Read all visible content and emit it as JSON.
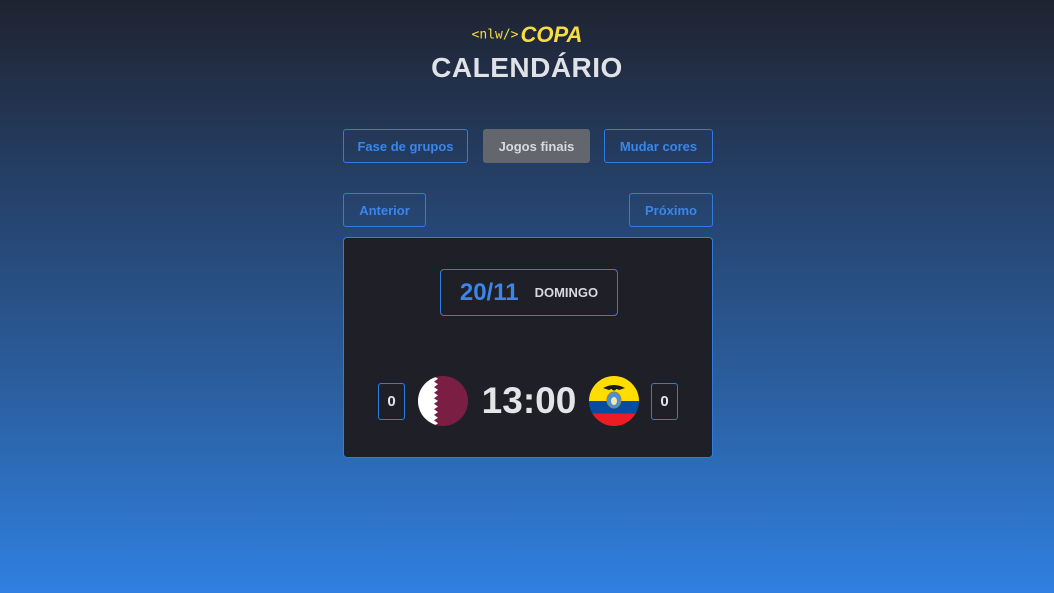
{
  "header": {
    "logo_tag": "<nlw/>",
    "logo_brand": "COPA",
    "title": "CALENDÁRIO"
  },
  "tabs": [
    {
      "label": "Fase de grupos",
      "active": false
    },
    {
      "label": "Jogos finais",
      "active": true
    },
    {
      "label": "Mudar cores",
      "active": false
    }
  ],
  "nav": {
    "prev_label": "Anterior",
    "next_label": "Próximo"
  },
  "card": {
    "date": "20/11",
    "weekday": "DOMINGO",
    "match": {
      "home_score": "0",
      "home_flag": "qatar-flag-icon",
      "time": "13:00",
      "away_flag": "ecuador-flag-icon",
      "away_score": "0"
    }
  },
  "colors": {
    "accent": "#2f7de0",
    "logo": "#f7dd43",
    "card_bg": "#1f2027",
    "qatar_maroon": "#8a1538",
    "ecuador_yellow": "#ffdd00",
    "ecuador_blue": "#034ea2",
    "ecuador_red": "#ed1c24"
  }
}
